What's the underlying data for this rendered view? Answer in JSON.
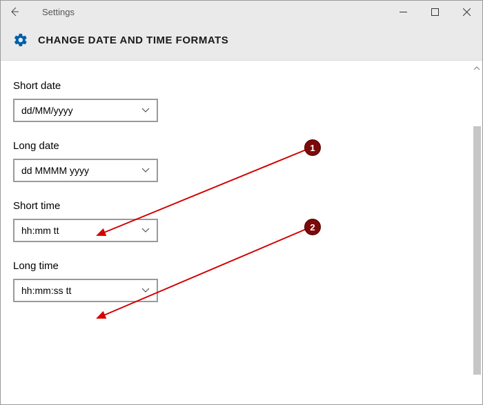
{
  "titlebar": {
    "app_title": "Settings"
  },
  "header": {
    "page_title": "CHANGE DATE AND TIME FORMATS"
  },
  "fields": {
    "short_date": {
      "label": "Short date",
      "value": "dd/MM/yyyy"
    },
    "long_date": {
      "label": "Long date",
      "value": "dd MMMM yyyy"
    },
    "short_time": {
      "label": "Short time",
      "value": "hh:mm tt"
    },
    "long_time": {
      "label": "Long time",
      "value": "hh:mm:ss tt"
    }
  },
  "annotations": {
    "arrow1": {
      "number": "1"
    },
    "arrow2": {
      "number": "2"
    }
  },
  "colors": {
    "annotation_bg": "#7c0a0a",
    "annotation_arrow": "#d40000"
  }
}
